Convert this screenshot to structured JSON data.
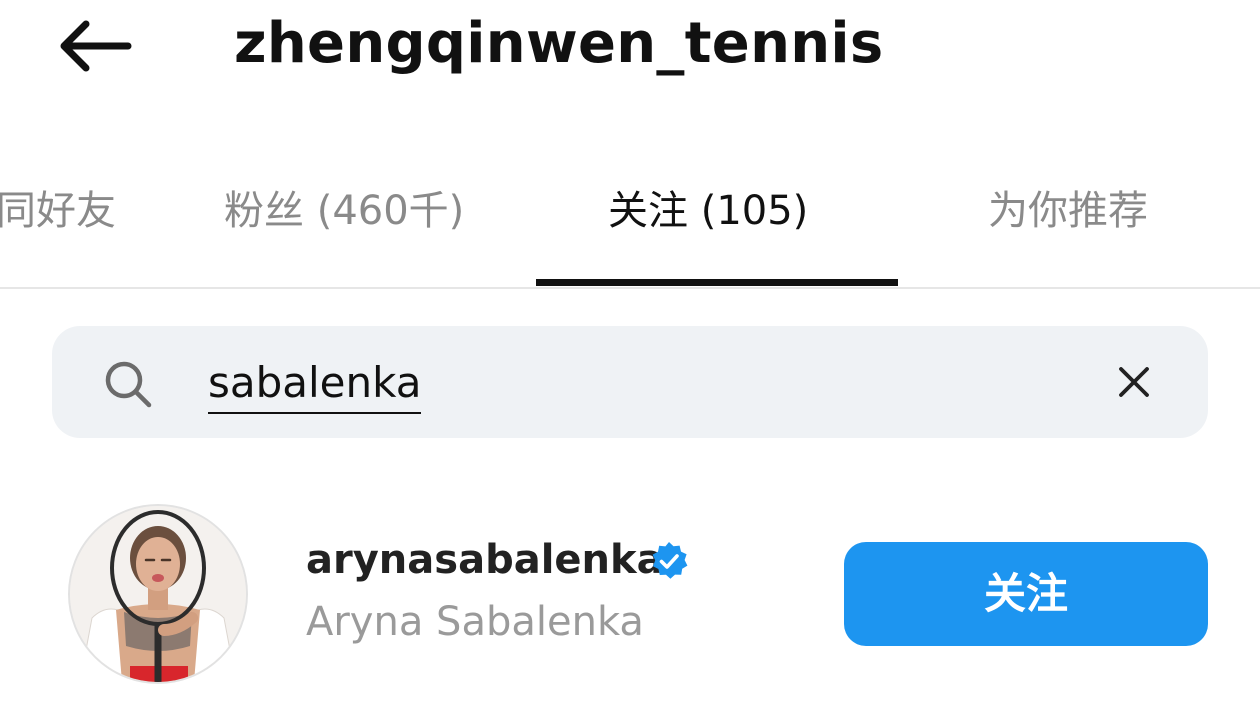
{
  "header": {
    "back_icon": "arrow-left-icon",
    "username": "zhengqinwen_tennis"
  },
  "tabs": [
    {
      "label": "同好友",
      "active": false
    },
    {
      "label": "粉丝 (460千)",
      "active": false
    },
    {
      "label": "关注 (105)",
      "active": true
    },
    {
      "label": "为你推荐",
      "active": false
    }
  ],
  "search": {
    "icon": "search-icon",
    "value": "sabalenka",
    "clear_icon": "close-icon"
  },
  "results": [
    {
      "username": "arynasabalenka",
      "verified": true,
      "full_name": "Aryna Sabalenka",
      "button_label": "关注"
    }
  ],
  "colors": {
    "accent": "#1d95f0",
    "search_bg": "#eff2f5",
    "secondary_text": "#9a9a9a",
    "verified": "#1d95f0"
  }
}
